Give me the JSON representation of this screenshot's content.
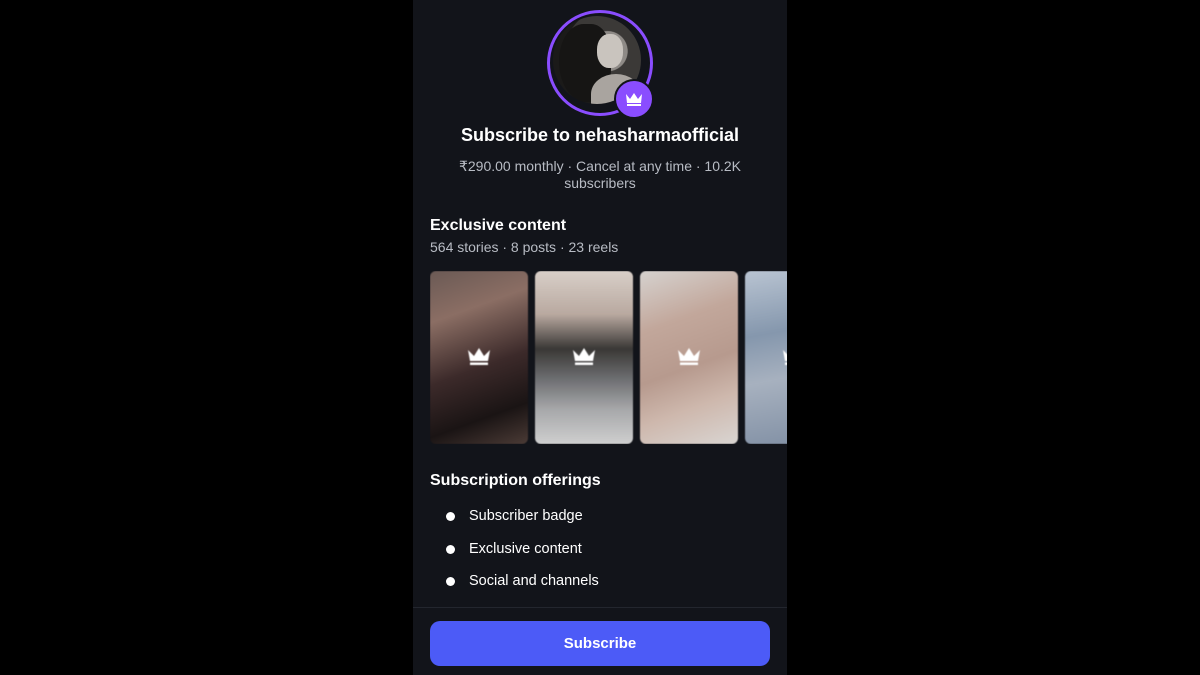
{
  "profile": {
    "title": "Subscribe to nehasharmaofficial",
    "subtitle": "₹290.00 monthly · Cancel at any time · 10.2K subscribers",
    "avatar_icon": "profile-photo",
    "badge_icon": "crown-icon"
  },
  "exclusive": {
    "title": "Exclusive content",
    "stats": "564 stories · 8 posts · 23 reels",
    "thumbnails": [
      {
        "icon": "crown-icon"
      },
      {
        "icon": "crown-icon"
      },
      {
        "icon": "crown-icon"
      },
      {
        "icon": "crown-icon"
      }
    ]
  },
  "offerings": {
    "title": "Subscription offerings",
    "items": [
      "Subscriber badge",
      "Exclusive content",
      "Social and channels"
    ]
  },
  "subscribe_button": {
    "label": "Subscribe"
  },
  "colors": {
    "background": "#12141a",
    "accent_purple": "#8a4dff",
    "button_blue": "#4c5bf7",
    "secondary_text": "#b8bcc4"
  }
}
